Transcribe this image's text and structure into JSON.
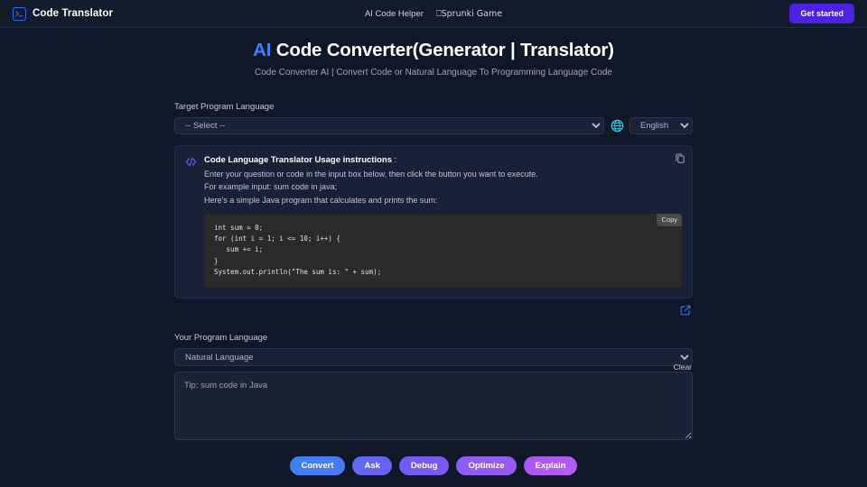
{
  "header": {
    "brand_name": "Code Translator",
    "logo_icon": "terminal-prompt-icon",
    "nav": [
      {
        "label": "AI Code Helper"
      },
      {
        "label": "⎕Sprunki Game"
      }
    ],
    "cta_label": "Get started",
    "cta_color": "#4b21e2"
  },
  "hero": {
    "title_accent": "AI",
    "title_rest": " Code Converter(Generator | Translator)",
    "accent_color": "#3b82f6",
    "subtitle": "Code Converter AI | Convert Code or Natural Language To Programming Language Code"
  },
  "target_section": {
    "label": "Target Program Language",
    "select_value": "-- Select --",
    "select_options": [
      "-- Select --"
    ],
    "globe_icon": "globe-icon",
    "globe_color": "#22d3ee",
    "ui_language_value": "English",
    "ui_language_options": [
      "English"
    ]
  },
  "instructions_card": {
    "icon": "code-brackets-icon",
    "icon_color": "#5b5bf0",
    "title": "Code Language Translator Usage instructions",
    "title_suffix": " :",
    "lines": [
      "Enter your question or code in the input box below, then click the button you want to execute.",
      "For example input: sum code in java;",
      "Here's a simple Java program that calculates and prints the sum:"
    ],
    "copy_icon": "copy-icon",
    "code_copy_label": "Copy",
    "code": "int sum = 0;\nfor (int i = 1; i <= 10; i++) {\n   sum += i;\n}\nSystem.out.println(\"The sum is: \" + sum);",
    "edit_icon": "edit-square-icon",
    "edit_icon_color": "#3b82f6"
  },
  "your_section": {
    "label": "Your Program Language",
    "select_value": "Natural Language",
    "select_options": [
      "Natural Language"
    ],
    "textarea_placeholder": "Tip: sum code in Java",
    "textarea_value": "",
    "clear_label": "Clear"
  },
  "actions": [
    {
      "label": "Convert",
      "color_from": "#3b82f6",
      "color_to": "#4a78f5"
    },
    {
      "label": "Ask",
      "color_from": "#5b6ef0",
      "color_to": "#6f5cf2"
    },
    {
      "label": "Debug",
      "color_from": "#6c5cf2",
      "color_to": "#7f56f0"
    },
    {
      "label": "Optimize",
      "color_from": "#8b5cf6",
      "color_to": "#9b57f2"
    },
    {
      "label": "Explain",
      "color_from": "#a855f7",
      "color_to": "#b45ef0"
    }
  ]
}
